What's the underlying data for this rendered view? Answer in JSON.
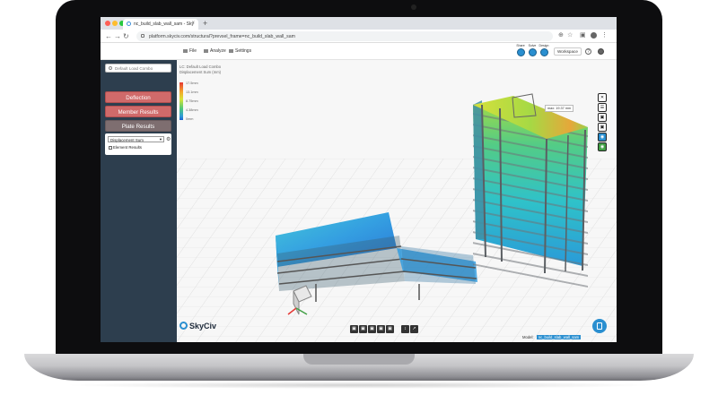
{
  "browser": {
    "tab_title": "nc_build_slab_wall_sam - Sky",
    "url": "platform.skyciv.com/structural?prevsel_frame=nc_build_slab_wall_sam",
    "traffic_colors": [
      "#ff5f56",
      "#ffbd2e",
      "#27c93f"
    ]
  },
  "toolbar": {
    "menus": [
      "File",
      "Analyze",
      "Settings"
    ],
    "right_tools": [
      "Share",
      "Solve",
      "Design"
    ],
    "workspace_label": "Workspace"
  },
  "sidebar": {
    "load_combo_placeholder": "Default Load Combo",
    "buttons": [
      "Deflection",
      "Member Results",
      "Plate Results"
    ],
    "result_select": "Displacement Sum",
    "checkbox_label": "Element Results"
  },
  "viewport": {
    "legend_lines": [
      "LC: Default Load Combo",
      "Displacement Sum (mm)"
    ],
    "legend_ticks": [
      "17.5mm",
      "13.1mm",
      "8.75mm",
      "4.38mm",
      "0mm"
    ],
    "max_label": "max: 19.37 mm",
    "right_tools": [
      "✕",
      "☰",
      "▣",
      "▣",
      "◉",
      "◉"
    ],
    "bottom_tools": [
      "▣",
      "▣",
      "▣",
      "▣",
      "▣",
      "↕",
      "↗"
    ],
    "logo_text": "SkyCiv"
  },
  "status": {
    "label": "Model:",
    "model_name": "nc_build_slab_wall_sam"
  },
  "colors": {
    "sidebar_bg": "#2d3e4e",
    "button_red": "#d06a6a",
    "accent_blue": "#2a8fd0"
  }
}
